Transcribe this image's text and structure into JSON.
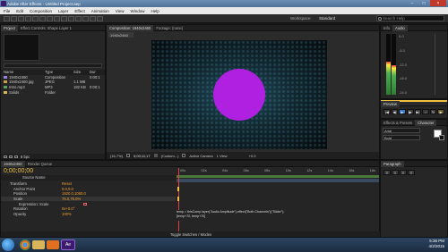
{
  "window": {
    "title": "Adobe After Effects - Untitled Project.aep"
  },
  "menu": [
    "File",
    "Edit",
    "Composition",
    "Layer",
    "Effect",
    "Animation",
    "View",
    "Window",
    "Help"
  ],
  "toolbar": {
    "workspace_label": "Workspace:",
    "workspace_value": "Standard",
    "search_placeholder": "Search Help"
  },
  "project": {
    "tabs": [
      "Project",
      "Effect Controls: Shape Layer 1"
    ],
    "columns": [
      "Name",
      "Type",
      "Size",
      "Dur"
    ],
    "items": [
      {
        "name": "1940x2460",
        "type": "Composition",
        "size": "",
        "dur": "0:00:1"
      },
      {
        "name": "1940x2460.jpg",
        "type": "JPEG",
        "size": "1.1 MB",
        "dur": ""
      },
      {
        "name": "Intro.mp3",
        "type": "MP3",
        "size": "182 KB",
        "dur": "0:00:1"
      },
      {
        "name": "Solids",
        "type": "Folder",
        "size": "",
        "dur": ""
      }
    ],
    "footer": "8 bpc"
  },
  "composition": {
    "tabs": [
      "Composition: 1940x2460",
      "Footage: (none)"
    ],
    "subtab": "1940x2460",
    "footer": {
      "zoom": "(16.7%)",
      "time": "0;00;11;17",
      "resolution": "(Custom...)",
      "view": "Active Camera",
      "views": "1 View",
      "exposure": "+0.0"
    }
  },
  "audio": {
    "tabs": [
      "Info",
      "Audio"
    ],
    "db_labels": [
      "0.0",
      "-6.0",
      "-12.0",
      "-18.0",
      "-24.0"
    ],
    "levels": [
      0.55,
      0.48
    ]
  },
  "preview": {
    "tab": "Preview"
  },
  "effects": {
    "tabs": [
      "Effects & Presets",
      "Character"
    ],
    "font": "Arial",
    "style": "Bold"
  },
  "paragraph": {
    "tab": "Paragraph"
  },
  "timeline": {
    "tabs": [
      "1940x2460",
      "Render Queue"
    ],
    "timecode": "0;00;00;00",
    "column_header": "Source Name",
    "rows": [
      {
        "name": "Transform",
        "value": "Reset"
      },
      {
        "name": "Anchor Point",
        "value": "0.0,0.0"
      },
      {
        "name": "Position",
        "value": "1920.0,1080.0"
      },
      {
        "name": "Scale",
        "value": "75.0,75.0%"
      },
      {
        "name": "Expression: Scale",
        "value": ""
      },
      {
        "name": "Rotation",
        "value": "0x+0.0°"
      },
      {
        "name": "Opacity",
        "value": "100%"
      }
    ],
    "ruler": [
      "00s",
      "02s",
      "04s",
      "06s",
      "08s",
      "10s",
      "12s",
      "14s",
      "16s",
      "18s"
    ],
    "expression_text": "temp = thisComp.layer(\"Audio Amplitude\").effect(\"Both Channels\")(\"Slider\");\n[temp+70, temp+70]",
    "footer": "Toggle Switches / Modes"
  },
  "taskbar": {
    "time": "5:36 PM",
    "date": "4/2/2015"
  },
  "colors": {
    "accent": "#f0c040",
    "circle": "#b020e0",
    "play": "#2a7ad0"
  }
}
